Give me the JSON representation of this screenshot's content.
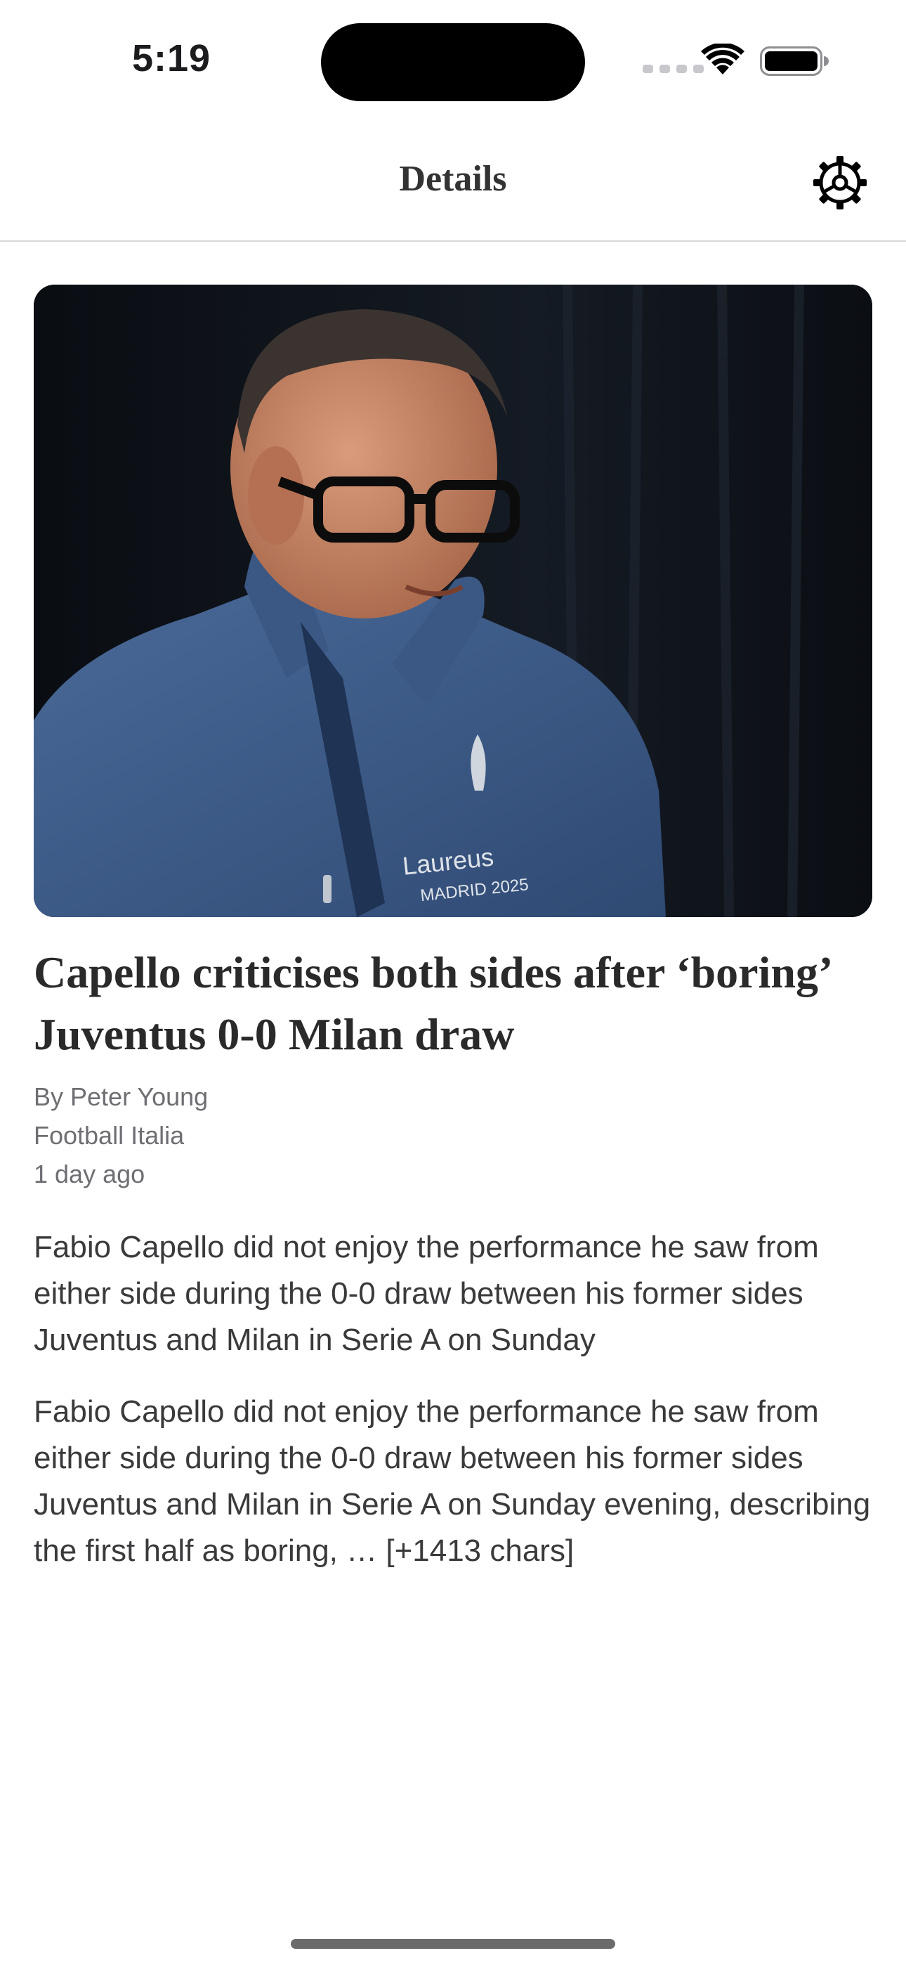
{
  "status_bar": {
    "time": "5:19"
  },
  "nav": {
    "title": "Details",
    "settings_icon": "gear-icon"
  },
  "article": {
    "image_description": "photo-of-man-in-blue-laureus-zip-top",
    "image_shirt_text": [
      "Laureus",
      "MADRID 2025"
    ],
    "headline": "Capello criticises both sides after ‘boring’ Juventus 0-0 Milan draw",
    "author": "By Peter Young",
    "source": "Football Italia",
    "published": "1 day ago",
    "summary": "Fabio Capello did not enjoy the performance he saw from either side during the 0-0 draw between his former sides Juventus and Milan in Serie A on Sunday",
    "content": "Fabio Capello did not enjoy the performance he saw from either side during the 0-0 draw between his former sides Juventus and Milan in Serie A on Sunday evening, describing the first half as boring, … [+1413 chars]"
  }
}
